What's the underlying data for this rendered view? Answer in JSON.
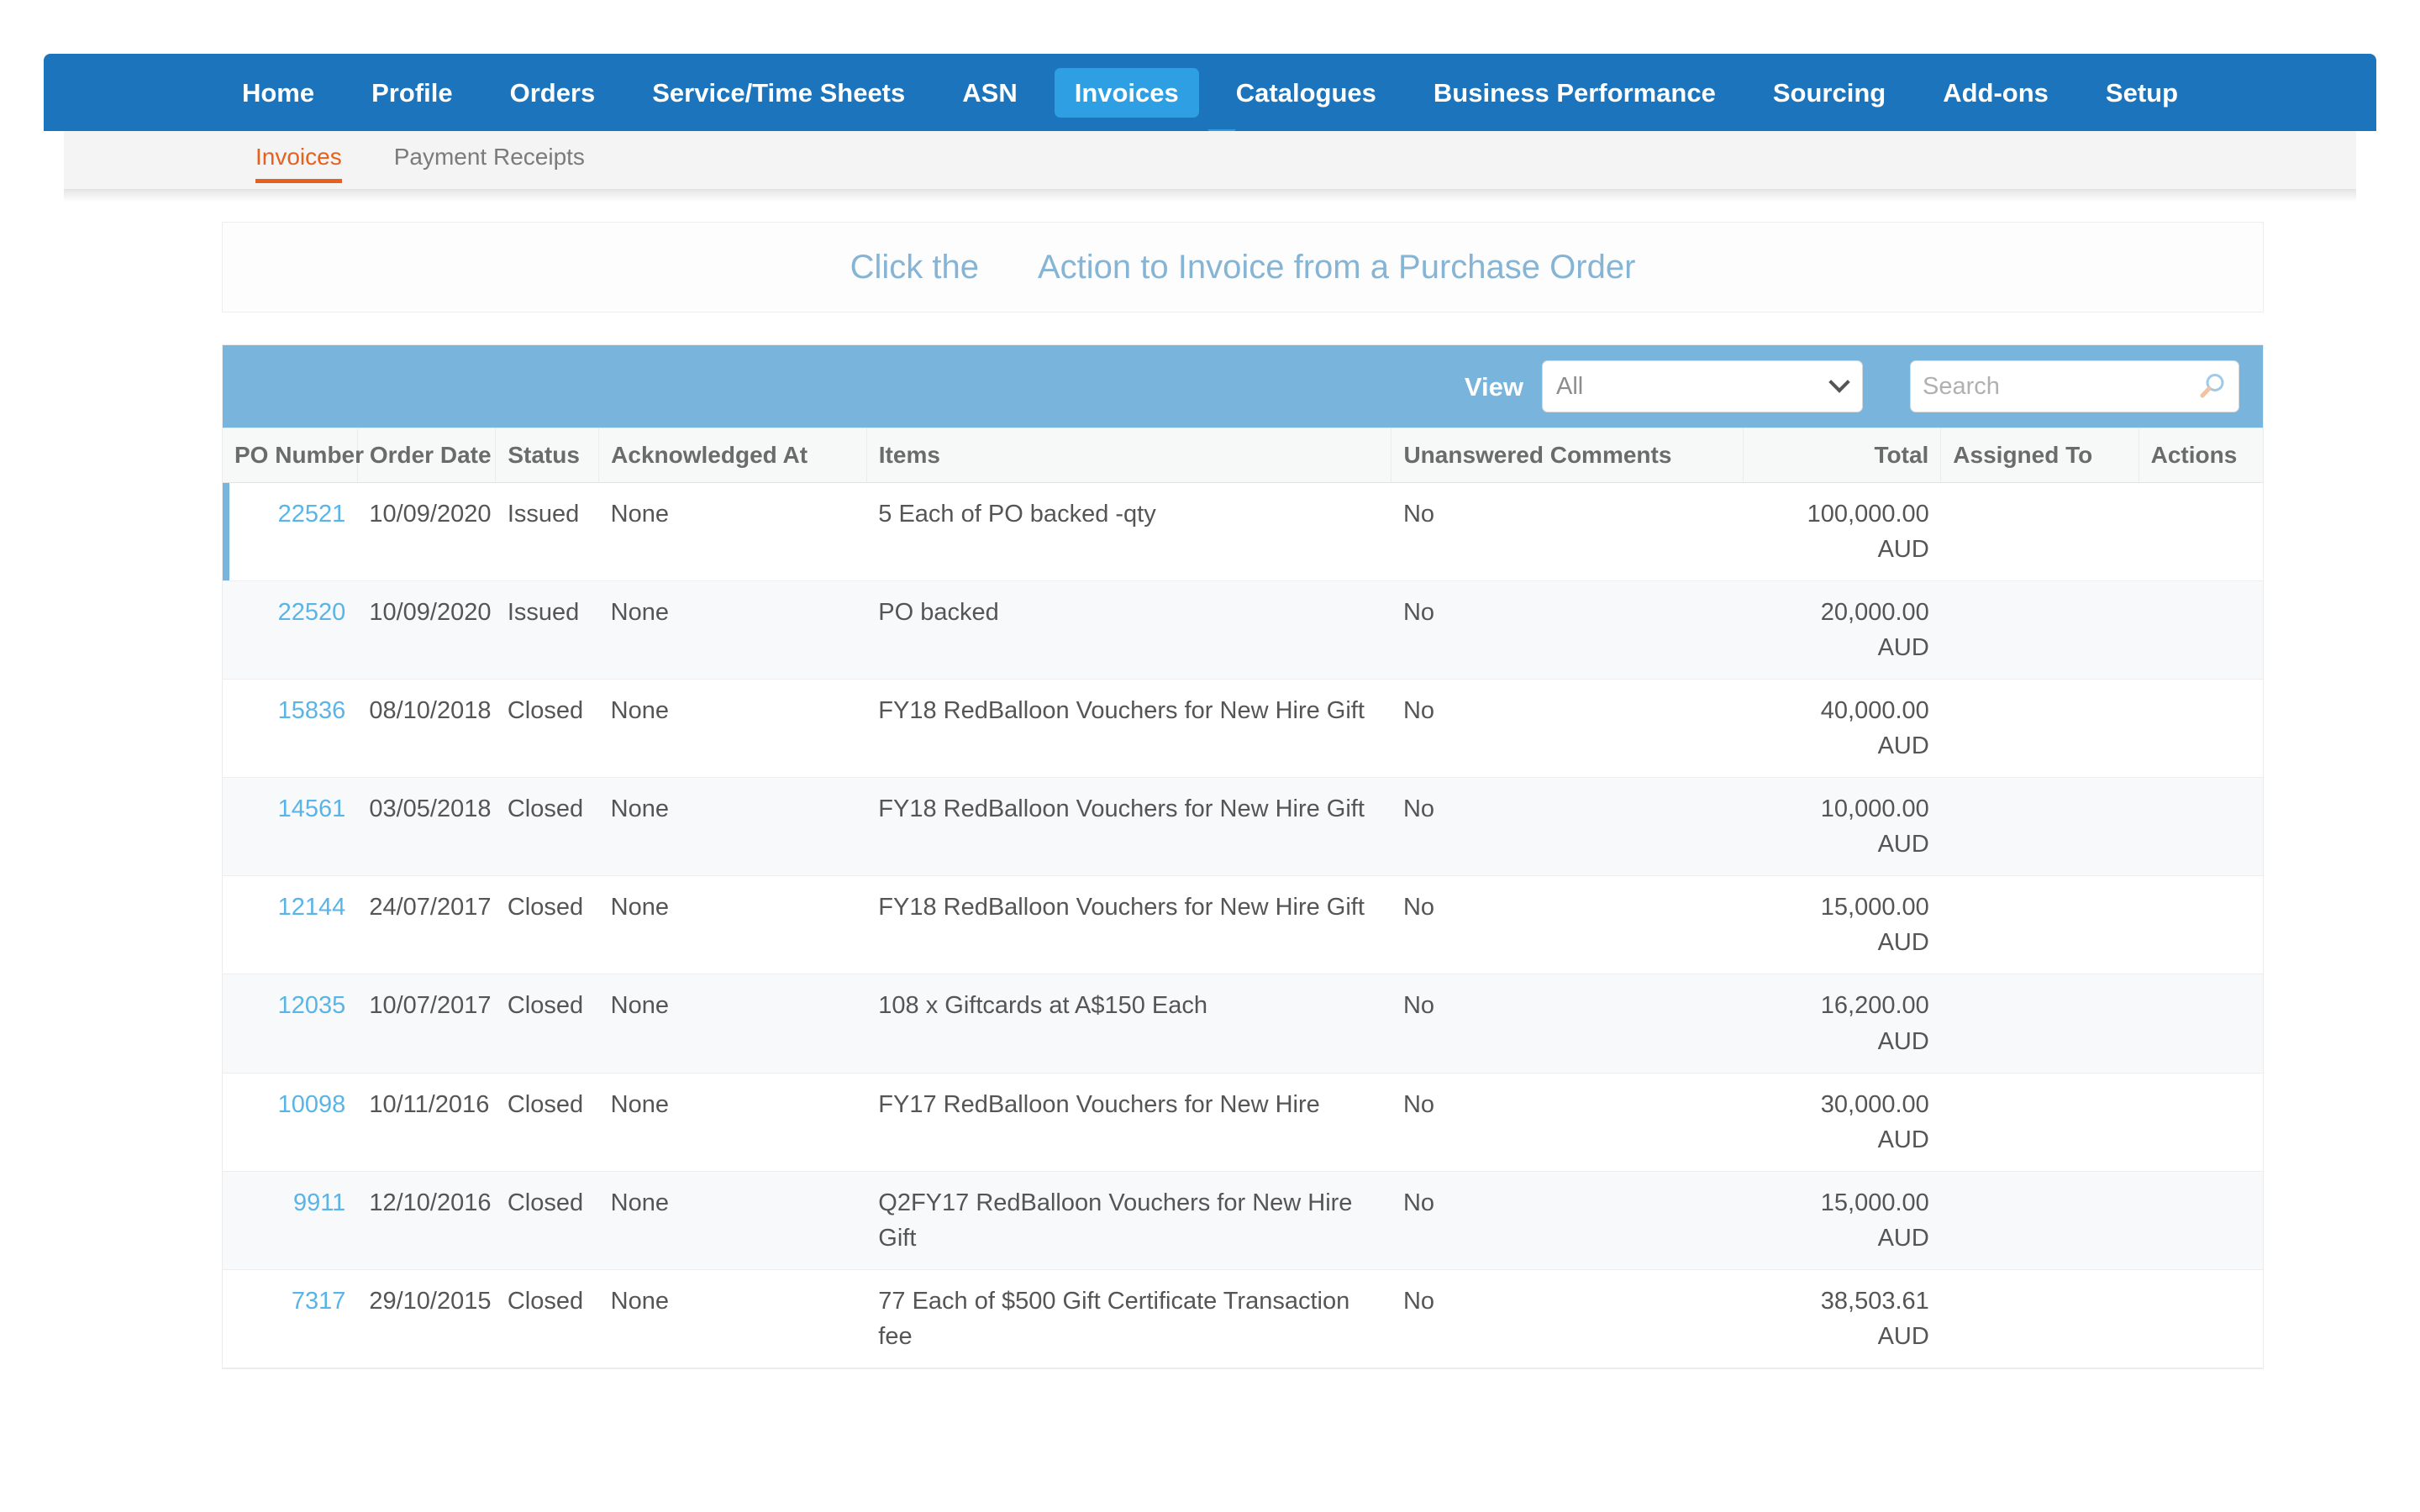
{
  "top_nav": {
    "items": [
      {
        "label": "Home",
        "active": false
      },
      {
        "label": "Profile",
        "active": false
      },
      {
        "label": "Orders",
        "active": false
      },
      {
        "label": "Service/Time Sheets",
        "active": false
      },
      {
        "label": "ASN",
        "active": false
      },
      {
        "label": "Invoices",
        "active": true
      },
      {
        "label": "Catalogues",
        "active": false
      },
      {
        "label": "Business Performance",
        "active": false
      },
      {
        "label": "Sourcing",
        "active": false
      },
      {
        "label": "Add-ons",
        "active": false
      },
      {
        "label": "Setup",
        "active": false
      }
    ],
    "active_color": "#2e9fe3",
    "bar_color": "#1c75bc"
  },
  "sub_nav": {
    "items": [
      {
        "label": "Invoices",
        "active": true
      },
      {
        "label": "Payment Receipts",
        "active": false
      }
    ],
    "active_color": "#e8601d"
  },
  "headline": {
    "prefix": "Click the",
    "icon": "coin-stack-icon",
    "suffix": "Action to Invoice from a Purchase Order",
    "color": "#86b4d4"
  },
  "toolbar": {
    "view_label": "View",
    "view_selected": "All",
    "view_options": [
      "All"
    ],
    "search_placeholder": "Search",
    "search_value": "",
    "search_icon": "search-icon",
    "background": "#79b4dd"
  },
  "table": {
    "columns": [
      {
        "key": "po_number",
        "label": "PO Number",
        "align": "right"
      },
      {
        "key": "order_date",
        "label": "Order Date",
        "align": "left"
      },
      {
        "key": "status",
        "label": "Status",
        "align": "left"
      },
      {
        "key": "acknowledged_at",
        "label": "Acknowledged At",
        "align": "left"
      },
      {
        "key": "items",
        "label": "Items",
        "align": "left"
      },
      {
        "key": "unanswered_comments",
        "label": "Unanswered Comments",
        "align": "left"
      },
      {
        "key": "total",
        "label": "Total",
        "align": "right"
      },
      {
        "key": "assigned_to",
        "label": "Assigned To",
        "align": "left"
      },
      {
        "key": "actions",
        "label": "Actions",
        "align": "left"
      }
    ],
    "rows": [
      {
        "po_number": "22521",
        "order_date": "10/09/2020",
        "status": "Issued",
        "acknowledged_at": "None",
        "items": "5 Each of PO backed -qty",
        "unanswered_comments": "No",
        "total_amount": "100,000.00",
        "total_currency": "AUD",
        "assigned_to": "",
        "actions": [
          "invoice-coin-yellow-icon",
          "credit-coin-red-icon"
        ],
        "selected": true
      },
      {
        "po_number": "22520",
        "order_date": "10/09/2020",
        "status": "Issued",
        "acknowledged_at": "None",
        "items": "PO backed",
        "unanswered_comments": "No",
        "total_amount": "20,000.00",
        "total_currency": "AUD",
        "assigned_to": "",
        "actions": [
          "invoice-coin-yellow-icon",
          "credit-coin-red-icon"
        ],
        "selected": false
      },
      {
        "po_number": "15836",
        "order_date": "08/10/2018",
        "status": "Closed",
        "acknowledged_at": "None",
        "items": "FY18 RedBalloon Vouchers for New Hire Gift",
        "unanswered_comments": "No",
        "total_amount": "40,000.00",
        "total_currency": "AUD",
        "assigned_to": "",
        "actions": [],
        "selected": false
      },
      {
        "po_number": "14561",
        "order_date": "03/05/2018",
        "status": "Closed",
        "acknowledged_at": "None",
        "items": "FY18 RedBalloon Vouchers for New Hire Gift",
        "unanswered_comments": "No",
        "total_amount": "10,000.00",
        "total_currency": "AUD",
        "assigned_to": "",
        "actions": [],
        "selected": false
      },
      {
        "po_number": "12144",
        "order_date": "24/07/2017",
        "status": "Closed",
        "acknowledged_at": "None",
        "items": "FY18 RedBalloon Vouchers for New Hire Gift",
        "unanswered_comments": "No",
        "total_amount": "15,000.00",
        "total_currency": "AUD",
        "assigned_to": "",
        "actions": [],
        "selected": false
      },
      {
        "po_number": "12035",
        "order_date": "10/07/2017",
        "status": "Closed",
        "acknowledged_at": "None",
        "items": "108 x Giftcards at A$150 Each",
        "unanswered_comments": "No",
        "total_amount": "16,200.00",
        "total_currency": "AUD",
        "assigned_to": "",
        "actions": [],
        "selected": false
      },
      {
        "po_number": "10098",
        "order_date": "10/11/2016",
        "status": "Closed",
        "acknowledged_at": "None",
        "items": "FY17 RedBalloon Vouchers for New Hire",
        "unanswered_comments": "No",
        "total_amount": "30,000.00",
        "total_currency": "AUD",
        "assigned_to": "",
        "actions": [],
        "selected": false
      },
      {
        "po_number": "9911",
        "order_date": "12/10/2016",
        "status": "Closed",
        "acknowledged_at": "None",
        "items": "Q2FY17 RedBalloon Vouchers for New Hire Gift",
        "unanswered_comments": "No",
        "total_amount": "15,000.00",
        "total_currency": "AUD",
        "assigned_to": "",
        "actions": [],
        "selected": false
      },
      {
        "po_number": "7317",
        "order_date": "29/10/2015",
        "status": "Closed",
        "acknowledged_at": "None",
        "items": "77 Each of $500 Gift Certificate Transaction fee",
        "unanswered_comments": "No",
        "total_amount": "38,503.61",
        "total_currency": "AUD",
        "assigned_to": "",
        "actions": [],
        "selected": false
      }
    ]
  }
}
